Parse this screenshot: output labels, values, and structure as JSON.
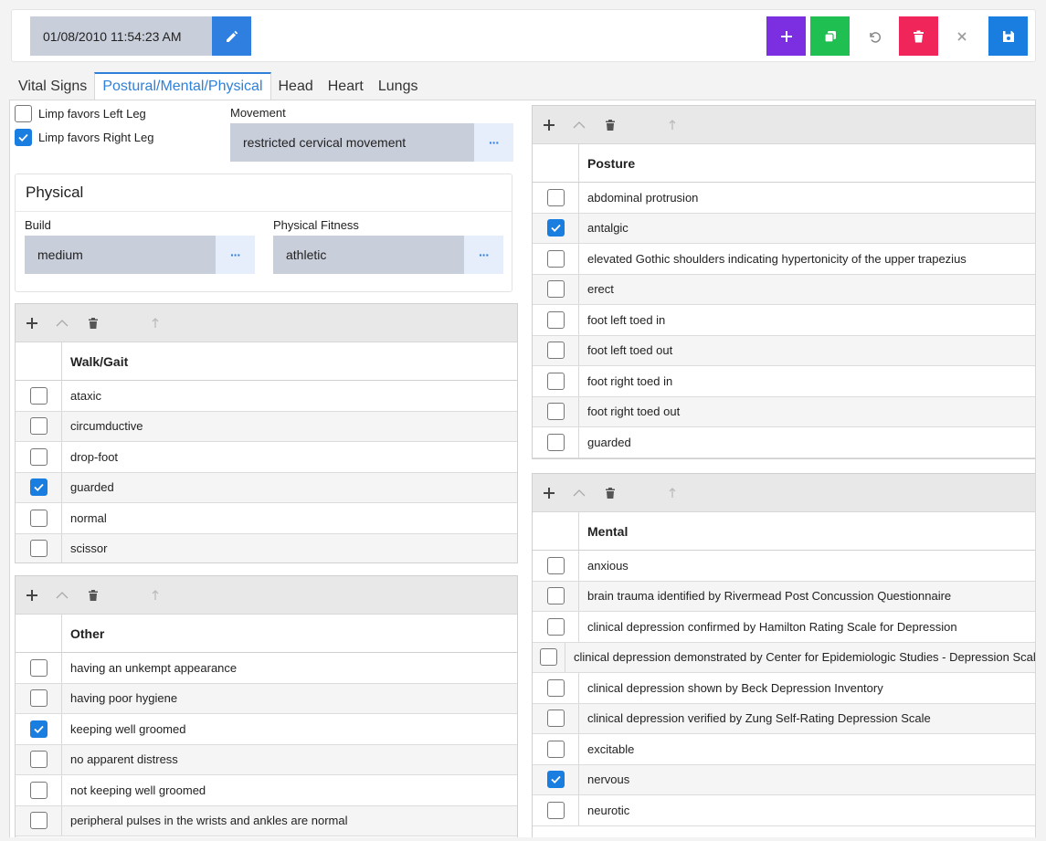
{
  "toolbar": {
    "datetime": "01/08/2010 11:54:23 AM",
    "colors": {
      "add": "#7b2fe0",
      "copy": "#1fbf52",
      "delete": "#f0265a",
      "save": "#1a7de0",
      "edit": "#2f7fe0"
    }
  },
  "tabs": [
    {
      "label": "Vital Signs",
      "active": false
    },
    {
      "label": "Postural/Mental/Physical",
      "active": true
    },
    {
      "label": "Head",
      "active": false
    },
    {
      "label": "Heart",
      "active": false
    },
    {
      "label": "Lungs",
      "active": false
    }
  ],
  "limp": {
    "left": {
      "label": "Limp favors Left Leg",
      "checked": false
    },
    "right": {
      "label": "Limp favors Right Leg",
      "checked": true
    }
  },
  "movement": {
    "label": "Movement",
    "value": "restricted cervical movement",
    "button": "···"
  },
  "physical": {
    "title": "Physical",
    "build": {
      "label": "Build",
      "value": "medium",
      "button": "···"
    },
    "fitness": {
      "label": "Physical Fitness",
      "value": "athletic",
      "button": "···"
    }
  },
  "walk": {
    "header": "Walk/Gait",
    "rows": [
      {
        "text": "ataxic",
        "checked": false
      },
      {
        "text": "circumductive",
        "checked": false
      },
      {
        "text": "drop-foot",
        "checked": false
      },
      {
        "text": "guarded",
        "checked": true
      },
      {
        "text": "normal",
        "checked": false
      },
      {
        "text": "scissor",
        "checked": false
      }
    ]
  },
  "other": {
    "header": "Other",
    "rows": [
      {
        "text": "having an unkempt appearance",
        "checked": false
      },
      {
        "text": "having poor hygiene",
        "checked": false
      },
      {
        "text": "keeping well groomed",
        "checked": true
      },
      {
        "text": "no apparent distress",
        "checked": false
      },
      {
        "text": "not keeping well groomed",
        "checked": false
      },
      {
        "text": "peripheral pulses in the wrists and ankles are normal",
        "checked": false
      }
    ]
  },
  "posture": {
    "header": "Posture",
    "rows": [
      {
        "text": "abdominal protrusion",
        "checked": false
      },
      {
        "text": "antalgic",
        "checked": true
      },
      {
        "text": "elevated Gothic shoulders indicating hypertonicity of the upper trapezius",
        "checked": false
      },
      {
        "text": "erect",
        "checked": false
      },
      {
        "text": "foot left toed in",
        "checked": false
      },
      {
        "text": "foot left toed out",
        "checked": false
      },
      {
        "text": "foot right toed in",
        "checked": false
      },
      {
        "text": "foot right toed out",
        "checked": false
      },
      {
        "text": "guarded",
        "checked": false
      }
    ]
  },
  "mental": {
    "header": "Mental",
    "rows": [
      {
        "text": "anxious",
        "checked": false
      },
      {
        "text": "brain trauma identified by Rivermead Post Concussion Questionnaire",
        "checked": false
      },
      {
        "text": "clinical depression confirmed by Hamilton Rating Scale for Depression",
        "checked": false
      },
      {
        "text": "clinical depression demonstrated by Center for Epidemiologic Studies - Depression Scale",
        "checked": false
      },
      {
        "text": "clinical depression shown by Beck Depression Inventory",
        "checked": false
      },
      {
        "text": "clinical depression verified by Zung Self-Rating Depression Scale",
        "checked": false
      },
      {
        "text": "excitable",
        "checked": false
      },
      {
        "text": "nervous",
        "checked": true
      },
      {
        "text": "neurotic",
        "checked": false
      }
    ]
  }
}
